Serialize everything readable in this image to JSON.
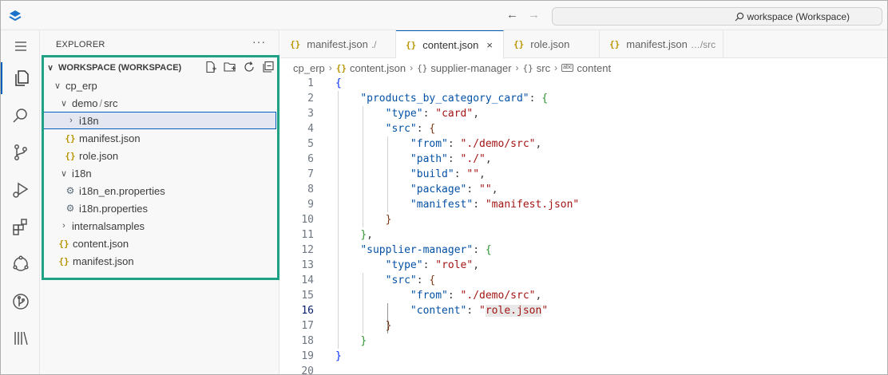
{
  "titlebar": {
    "search_text": "workspace (Workspace)",
    "back_icon": "arrow-left-icon",
    "forward_icon": "arrow-right-icon"
  },
  "activity_bar": [
    "menu-icon",
    "explorer-icon",
    "search-icon",
    "source-control-icon",
    "run-debug-icon",
    "extensions-icon",
    "remote-icon",
    "git-graph-icon",
    "library-icon"
  ],
  "sidebar": {
    "title": "EXPLORER",
    "more": "···",
    "workspace_label": "WORKSPACE (WORKSPACE)",
    "tree": [
      {
        "label": "cp_erp",
        "kind": "folder",
        "expanded": true,
        "depth": 1
      },
      {
        "label": "demo",
        "label_suffix": "src",
        "kind": "folder",
        "expanded": true,
        "depth": 2
      },
      {
        "label": "i18n",
        "kind": "folder",
        "expanded": false,
        "depth": 3,
        "selected": true
      },
      {
        "label": "manifest.json",
        "kind": "json",
        "depth": 3
      },
      {
        "label": "role.json",
        "kind": "json",
        "depth": 3
      },
      {
        "label": "i18n",
        "kind": "folder",
        "expanded": true,
        "depth": 2
      },
      {
        "label": "i18n_en.properties",
        "kind": "properties",
        "depth": 3
      },
      {
        "label": "i18n.properties",
        "kind": "properties",
        "depth": 3
      },
      {
        "label": "internalsamples",
        "kind": "folder",
        "expanded": false,
        "depth": 2
      },
      {
        "label": "content.json",
        "kind": "json",
        "depth": 2
      },
      {
        "label": "manifest.json",
        "kind": "json",
        "depth": 2
      }
    ],
    "highlight_color": "#1fa186"
  },
  "tabs": [
    {
      "label": "manifest.json",
      "desc": "./"
    },
    {
      "label": "content.json",
      "active": true,
      "close": "×"
    },
    {
      "label": "role.json"
    },
    {
      "label": "manifest.json",
      "desc": "…/src"
    }
  ],
  "breadcrumbs": [
    "cp_erp",
    "content.json",
    "supplier-manager",
    "src",
    "content"
  ],
  "editor": {
    "current_line": 16,
    "lines": [
      "1",
      "2",
      "3",
      "4",
      "5",
      "6",
      "7",
      "8",
      "9",
      "10",
      "11",
      "12",
      "13",
      "14",
      "15",
      "16",
      "17",
      "18",
      "19",
      "20"
    ],
    "code": {
      "l2_key": "\"products_by_category_card\"",
      "type_key": "\"type\"",
      "l3_val": "\"card\"",
      "src_key": "\"src\"",
      "from_key": "\"from\"",
      "l5_val": "\"./demo/src\"",
      "path_key": "\"path\"",
      "l6_val": "\"./\"",
      "build_key": "\"build\"",
      "l7_val": "\"\"",
      "package_key": "\"package\"",
      "l8_val": "\"\"",
      "manifest_key": "\"manifest\"",
      "l9_val": "\"manifest.json\"",
      "l12_key": "\"supplier-manager\"",
      "l13_val": "\"role\"",
      "l15_val": "\"./demo/src\"",
      "content_key": "\"content\"",
      "l16_val_q1": "\"",
      "l16_val": "role.json",
      "l16_val_q2": "\""
    }
  }
}
